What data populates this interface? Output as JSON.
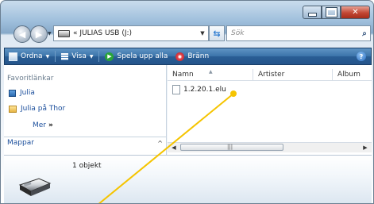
{
  "window": {
    "address": {
      "path": "« JULIAS USB (J:)"
    },
    "search": {
      "placeholder": "Sök"
    }
  },
  "toolbar": {
    "organize": "Ordna",
    "view": "Visa",
    "play_all": "Spela upp alla",
    "burn": "Bränn"
  },
  "left_pane": {
    "favorites_header": "Favoritlänkar",
    "favorites": [
      {
        "label": "Julia",
        "icon": "user-folder-icon"
      },
      {
        "label": "Julia på Thor",
        "icon": "folder-icon"
      }
    ],
    "more": "Mer",
    "folders": "Mappar"
  },
  "file_list": {
    "columns": [
      "Namn",
      "Artister",
      "Album"
    ],
    "files": [
      {
        "name": "1.2.20.1.elu"
      }
    ]
  },
  "details": {
    "count": "1 objekt"
  },
  "colors": {
    "toolbar": "#2f659c",
    "link": "#1c4f9c",
    "callout": "#f5c400"
  }
}
